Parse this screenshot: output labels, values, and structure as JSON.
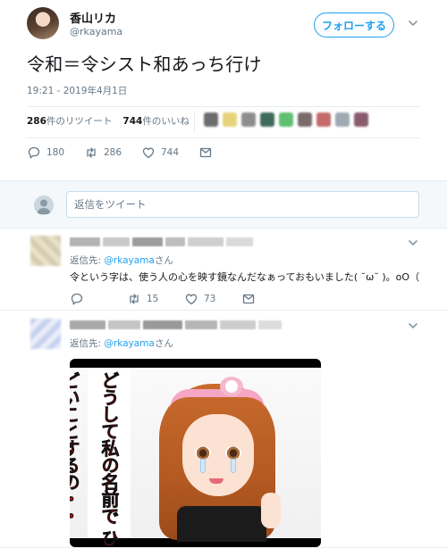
{
  "tweet": {
    "display_name": "香山リカ",
    "screen_name": "@rkayama",
    "follow_label": "フォローする",
    "text": "令和＝令シスト和あっち行け",
    "timestamp": "19:21 - 2019年4月1日",
    "stats": {
      "retweet_count": "286",
      "retweet_suffix": "件のリツイート",
      "like_count": "744",
      "like_suffix": "件のいいね"
    },
    "actions": {
      "reply_count": "180",
      "retweet_count": "286",
      "like_count": "744"
    }
  },
  "compose": {
    "placeholder": "返信をツイート"
  },
  "replies": [
    {
      "reply_to_prefix": "返信先: ",
      "reply_to_handle": "@rkayama",
      "reply_to_suffix": "さん",
      "text": "令という字は、使う人の心を映す鏡なんだなぁっておもいました( ˘ω˘ )。oO（",
      "actions": {
        "reply_count": "",
        "retweet_count": "15",
        "like_count": "73"
      }
    },
    {
      "reply_to_prefix": "返信先: ",
      "reply_to_handle": "@rkayama",
      "reply_to_suffix": "さん",
      "image_caption": "どうして私の名前で ひどいことするの・・"
    }
  ],
  "colors": {
    "accent": "#1da1f2",
    "text_secondary": "#657786",
    "divider": "#e6ecf0",
    "compose_bg": "#f5f8fa",
    "caption_red": "#e00000"
  },
  "icons": {
    "follow_menu": "chevron-down-icon",
    "reply": "reply-icon",
    "retweet": "retweet-icon",
    "like": "heart-icon",
    "dm": "envelope-icon"
  }
}
